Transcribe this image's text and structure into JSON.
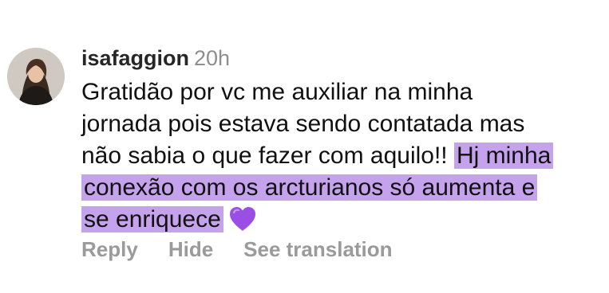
{
  "comment": {
    "username": "isafaggion",
    "timestamp": "20h",
    "lines": [
      {
        "plain": "Gratidão por vc me auxiliar na minha",
        "highlight": ""
      },
      {
        "plain": "jornada pois estava sendo contatada mas",
        "highlight": ""
      },
      {
        "plain": "não sabia o que fazer com aquilo!!",
        "highlight": "Hj minha"
      },
      {
        "plain": "",
        "highlight": "conexão com os arcturianos só aumenta e"
      },
      {
        "plain": "",
        "highlight": "se enriquece"
      }
    ],
    "emoji": "purple-heart-icon",
    "highlight_color": "#c5a3ec",
    "heart_color": "#9b4ee6"
  },
  "actions": {
    "reply_label": "Reply",
    "hide_label": "Hide",
    "translate_label": "See translation"
  }
}
